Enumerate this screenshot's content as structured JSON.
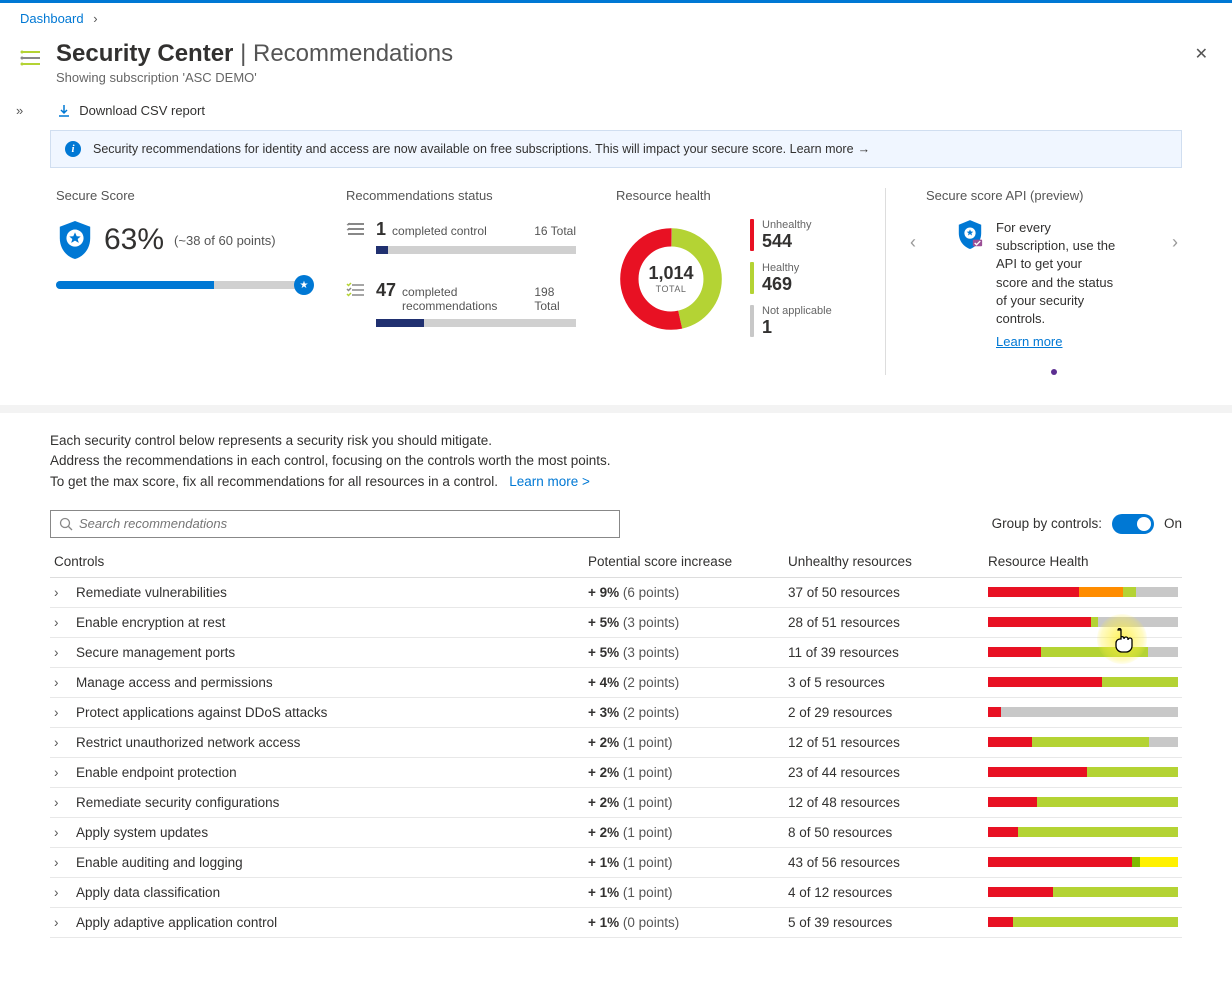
{
  "breadcrumb": {
    "dashboard": "Dashboard"
  },
  "header": {
    "title_main": "Security Center",
    "title_sub": "Recommendations",
    "subscription": "Showing subscription 'ASC DEMO'"
  },
  "toolbar": {
    "download": "Download CSV report"
  },
  "banner": {
    "text": "Security recommendations for identity and access are now available on free subscriptions. This will impact your secure score. ",
    "learn": "Learn more"
  },
  "secure_score": {
    "title": "Secure Score",
    "percent": "63%",
    "points": "(~38 of 60 points)",
    "fill_pct": 63
  },
  "rec_status": {
    "title": "Recommendations status",
    "controls_num": "1",
    "controls_label": "completed control",
    "controls_total": "16 Total",
    "controls_fill": 6,
    "recs_num": "47",
    "recs_label": "completed recommendations",
    "recs_total": "198 Total",
    "recs_fill": 24
  },
  "resource_health": {
    "title": "Resource health",
    "total_val": "1,014",
    "total_label": "TOTAL",
    "unhealthy_label": "Unhealthy",
    "unhealthy_val": "544",
    "healthy_label": "Healthy",
    "healthy_val": "469",
    "na_label": "Not applicable",
    "na_val": "1"
  },
  "api_card": {
    "title": "Secure score API (preview)",
    "text": "For every subscription, use the API to get your score and the status of your security controls.",
    "learn": "Learn more"
  },
  "intro": {
    "line1": "Each security control below represents a security risk you should mitigate.",
    "line2": "Address the recommendations in each control, focusing on the controls worth the most points.",
    "line3": "To get the max score, fix all recommendations for all resources in a control.",
    "learn": "Learn more >"
  },
  "search": {
    "placeholder": "Search recommendations"
  },
  "group_toggle": {
    "label": "Group by controls:",
    "state": "On"
  },
  "table": {
    "headers": {
      "controls": "Controls",
      "psi": "Potential score increase",
      "ur": "Unhealthy resources",
      "rh": "Resource Health"
    },
    "rows": [
      {
        "name": "Remediate vulnerabilities",
        "pct": "+ 9%",
        "pts": "(6 points)",
        "ur": "37 of 50 resources",
        "bars": [
          [
            "#e81123",
            48
          ],
          [
            "#ff8c00",
            23
          ],
          [
            "#b4d334",
            7
          ],
          [
            "#c8c8c8",
            22
          ]
        ]
      },
      {
        "name": "Enable encryption at rest",
        "pct": "+ 5%",
        "pts": "(3 points)",
        "ur": "28 of 51 resources",
        "bars": [
          [
            "#e81123",
            54
          ],
          [
            "#b4d334",
            4
          ],
          [
            "#c8c8c8",
            42
          ]
        ]
      },
      {
        "name": "Secure management ports",
        "pct": "+ 5%",
        "pts": "(3 points)",
        "ur": "11 of 39 resources",
        "bars": [
          [
            "#e81123",
            28
          ],
          [
            "#b4d334",
            56
          ],
          [
            "#c8c8c8",
            16
          ]
        ]
      },
      {
        "name": "Manage access and permissions",
        "pct": "+ 4%",
        "pts": "(2 points)",
        "ur": "3 of 5 resources",
        "bars": [
          [
            "#e81123",
            60
          ],
          [
            "#b4d334",
            40
          ]
        ]
      },
      {
        "name": "Protect applications against DDoS attacks",
        "pct": "+ 3%",
        "pts": "(2 points)",
        "ur": "2 of 29 resources",
        "bars": [
          [
            "#e81123",
            7
          ],
          [
            "#c8c8c8",
            93
          ]
        ]
      },
      {
        "name": "Restrict unauthorized network access",
        "pct": "+ 2%",
        "pts": "(1 point)",
        "ur": "12 of 51 resources",
        "bars": [
          [
            "#e81123",
            23
          ],
          [
            "#b4d334",
            62
          ],
          [
            "#c8c8c8",
            15
          ]
        ]
      },
      {
        "name": "Enable endpoint protection",
        "pct": "+ 2%",
        "pts": "(1 point)",
        "ur": "23 of 44 resources",
        "bars": [
          [
            "#e81123",
            52
          ],
          [
            "#b4d334",
            48
          ]
        ]
      },
      {
        "name": "Remediate security configurations",
        "pct": "+ 2%",
        "pts": "(1 point)",
        "ur": "12 of 48 resources",
        "bars": [
          [
            "#e81123",
            26
          ],
          [
            "#b4d334",
            74
          ]
        ]
      },
      {
        "name": "Apply system updates",
        "pct": "+ 2%",
        "pts": "(1 point)",
        "ur": "8 of 50 resources",
        "bars": [
          [
            "#e81123",
            16
          ],
          [
            "#b4d334",
            84
          ]
        ]
      },
      {
        "name": "Enable auditing and logging",
        "pct": "+ 1%",
        "pts": "(1 point)",
        "ur": "43 of 56 resources",
        "bars": [
          [
            "#e81123",
            76
          ],
          [
            "#7fba00",
            4
          ],
          [
            "#fff100",
            20
          ]
        ]
      },
      {
        "name": "Apply data classification",
        "pct": "+ 1%",
        "pts": "(1 point)",
        "ur": "4 of 12 resources",
        "bars": [
          [
            "#e81123",
            34
          ],
          [
            "#b4d334",
            66
          ]
        ]
      },
      {
        "name": "Apply adaptive application control",
        "pct": "+ 1%",
        "pts": "(0 points)",
        "ur": "5 of 39 resources",
        "bars": [
          [
            "#e81123",
            13
          ],
          [
            "#b4d334",
            87
          ]
        ]
      }
    ]
  },
  "colors": {
    "unhealthy": "#e81123",
    "healthy": "#b4d334",
    "na": "#c8c8c8",
    "blue": "#0078d4"
  }
}
